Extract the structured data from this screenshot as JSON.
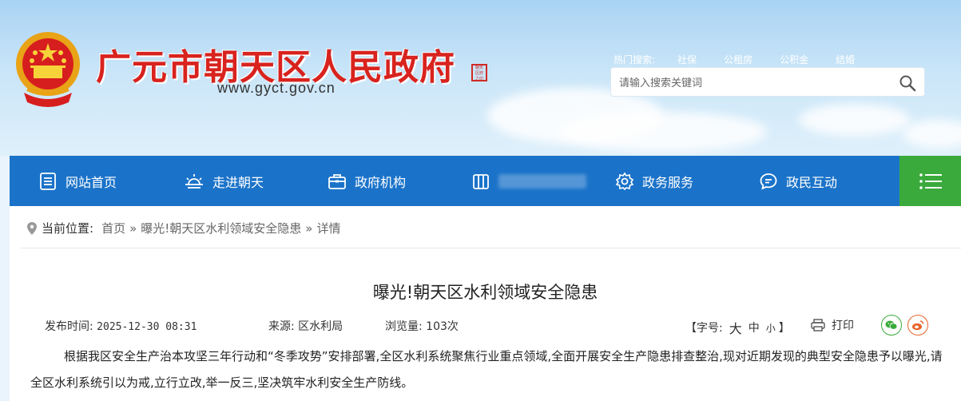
{
  "header": {
    "site_title": "广元市朝天区人民政府",
    "site_url": "www.gyct.gov.cn",
    "hot_search_label": "热门搜索:",
    "hot_search_items": [
      "社保",
      "公租房",
      "公积金",
      "结婚"
    ],
    "search_placeholder": "请输入搜索关键词"
  },
  "nav": {
    "items": [
      {
        "label": "网站首页",
        "icon": "document-icon"
      },
      {
        "label": "走进朝天",
        "icon": "sunrise-icon"
      },
      {
        "label": "政府机构",
        "icon": "briefcase-icon"
      },
      {
        "label": "",
        "icon": "building-icon"
      },
      {
        "label": "政务服务",
        "icon": "gear-icon"
      },
      {
        "label": "政民互动",
        "icon": "chat-icon"
      }
    ],
    "menu_icon": "menu-icon",
    "colors": {
      "bar": "#1b73c9",
      "menu": "#3aaa3c"
    }
  },
  "breadcrumb": {
    "label": "当前位置:",
    "crumbs": [
      "首页",
      "曝光!朝天区水利领域安全隐患",
      "详情"
    ],
    "separator": "»"
  },
  "article": {
    "title": "曝光!朝天区水利领域安全隐患",
    "publish_label": "发布时间:",
    "publish_time": "2025-12-30 08:31",
    "source_label": "来源:",
    "source": "区水利局",
    "views_label": "浏览量:",
    "views": "103次",
    "fontsize_label": "【字号:",
    "fontsize_options": [
      "大",
      "中",
      "小"
    ],
    "fontsize_close": "】",
    "print_label": "打印",
    "share_icons": [
      "wechat-icon",
      "weibo-icon"
    ],
    "body": "根据我区安全生产治本攻坚三年行动和“冬季攻势”安排部署,全区水利系统聚焦行业重点领域,全面开展安全生产隐患排查整治,现对近期发现的典型安全隐患予以曝光,请全区水利系统引以为戒,立行立改,举一反三,坚决筑牢水利安全生产防线。"
  }
}
